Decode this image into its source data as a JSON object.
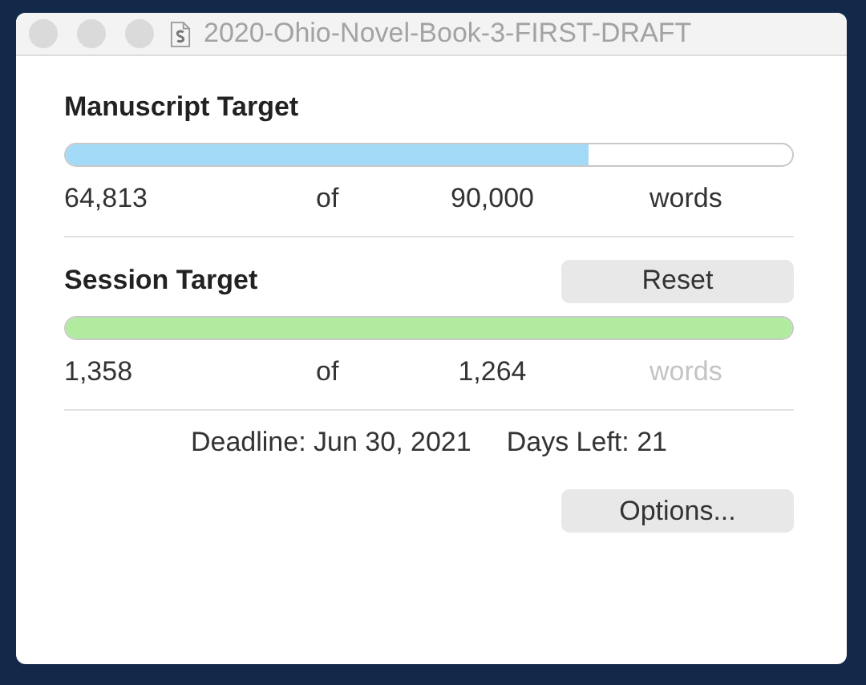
{
  "window": {
    "title": "2020-Ohio-Novel-Book-3-FIRST-DRAFT"
  },
  "manuscript": {
    "title": "Manuscript Target",
    "level": 0.72,
    "count": "64,813",
    "of": "of",
    "target": "90,000",
    "unit": "words",
    "unit_dimmed": false
  },
  "session": {
    "title": "Session Target",
    "reset_button": "Reset",
    "level": 1.0,
    "count": "1,358",
    "of": "of",
    "target": "1,264",
    "unit": "words",
    "unit_dimmed": true
  },
  "deadline": {
    "date": "Deadline: Jun 30, 2021",
    "days_left": "Days Left: 21"
  },
  "options_button": "Options..."
}
